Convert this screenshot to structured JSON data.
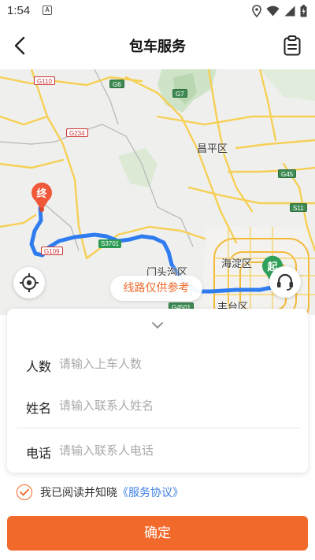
{
  "status_bar": {
    "time": "1:54",
    "notification_letter": "A"
  },
  "header": {
    "title": "包车服务"
  },
  "map": {
    "road_badges": [
      "G110",
      "G6",
      "G7",
      "G234",
      "S3701",
      "G109",
      "G45",
      "S11",
      "G4501"
    ],
    "districts": [
      "昌平区",
      "门头沟区",
      "海淀区",
      "丰台区"
    ],
    "start_marker": "起",
    "end_marker": "终",
    "route_hint": "线路仅供参考",
    "colors": {
      "route": "#2f7cf0",
      "start": "#2fa05a",
      "end": "#f0583a"
    }
  },
  "form": {
    "people": {
      "label": "人数",
      "placeholder": "请输入上车人数",
      "value": ""
    },
    "name": {
      "label": "姓名",
      "placeholder": "请输入联系人姓名",
      "value": ""
    },
    "phone": {
      "label": "电话",
      "placeholder": "请输入联系人电话",
      "value": ""
    }
  },
  "agreement": {
    "text": "我已阅读并知晓",
    "link": "《服务协议》",
    "checked": true
  },
  "confirm": {
    "label": "确定"
  },
  "accent_color": "#f26a2b"
}
